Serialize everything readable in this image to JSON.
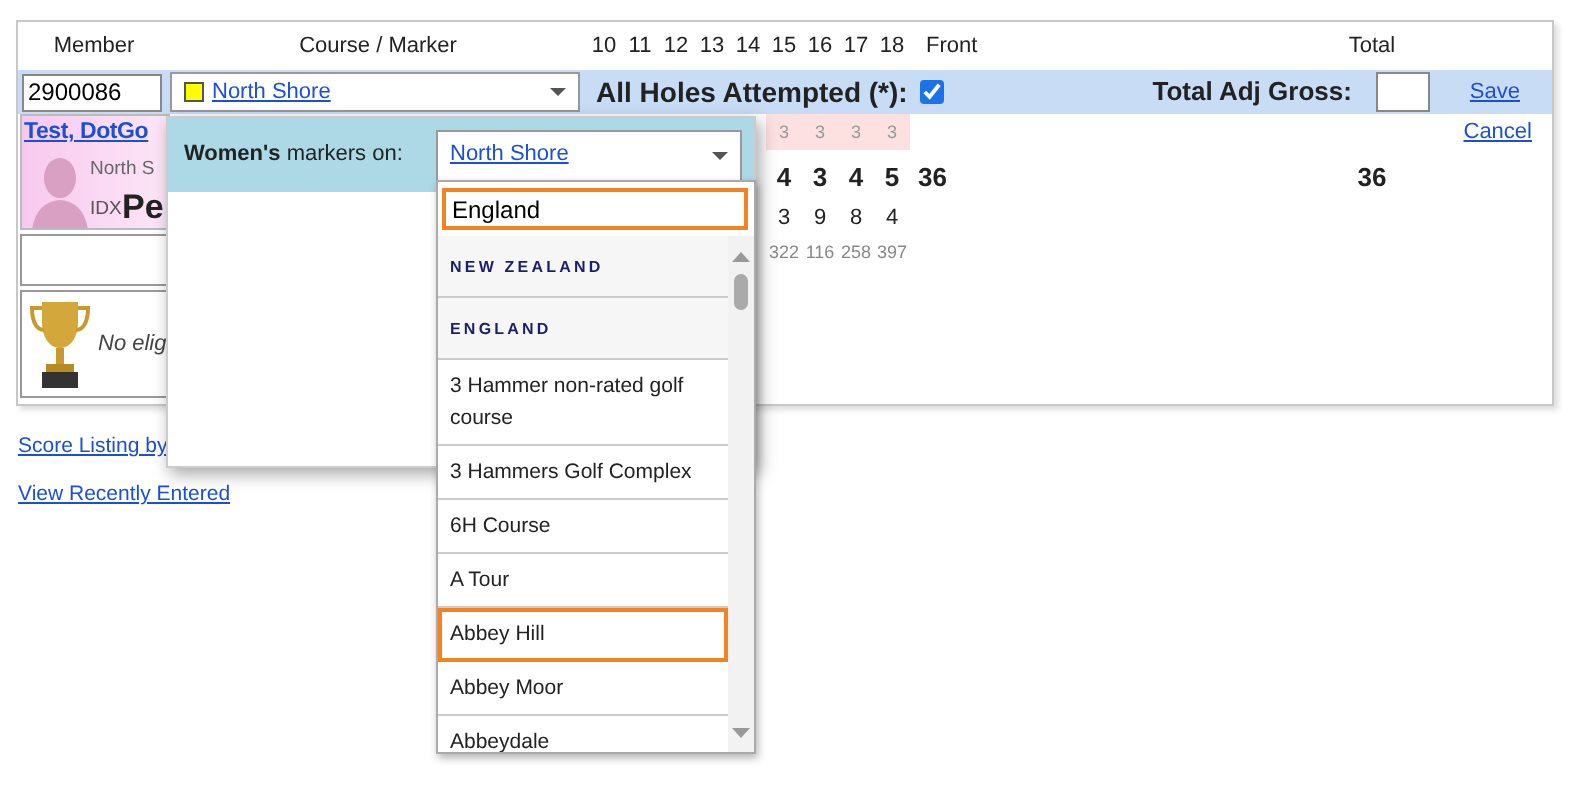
{
  "columns": [
    "Member",
    "Course / Marker",
    "10",
    "11",
    "12",
    "13",
    "14",
    "15",
    "16",
    "17",
    "18",
    "Front",
    "Total"
  ],
  "entry": {
    "member_id": "2900086",
    "course": {
      "label": "North Shore",
      "color": "#ffff00"
    },
    "all_holes_label": "All Holes Attempted (*):",
    "all_holes_checked": true,
    "total_label": "Total Adj Gross:",
    "save": "Save"
  },
  "player": {
    "name": "Test, DotGo",
    "club": "North S",
    "idx_label": "IDX",
    "handicap": "Pe"
  },
  "cancel": "Cancel",
  "par_cells": [
    "3",
    "3",
    "3",
    "3"
  ],
  "scores": [
    "4",
    "3",
    "4",
    "5"
  ],
  "front": "36",
  "total": "36",
  "stroke_index": [
    "3",
    "9",
    "8",
    "4"
  ],
  "yardage": [
    "322",
    "116",
    "258",
    "397"
  ],
  "competition": "No elig",
  "links": [
    "Score Listing by",
    "View Recently Entered"
  ],
  "popup": {
    "label": "**Women's** markers on:",
    "select": "North Shore"
  },
  "dropdown": {
    "search": "England",
    "items": [
      {
        "kind": "group",
        "label": "NEW ZEALAND",
        "selected": false
      },
      {
        "kind": "group",
        "label": "ENGLAND",
        "selected": false
      },
      {
        "kind": "option",
        "label": "3 Hammer non-rated golf course",
        "selected": false
      },
      {
        "kind": "option",
        "label": "3 Hammers Golf Complex",
        "selected": false
      },
      {
        "kind": "option",
        "label": "6H Course",
        "selected": false
      },
      {
        "kind": "option",
        "label": "A Tour",
        "selected": false
      },
      {
        "kind": "option",
        "label": "Abbey Hill",
        "selected": true
      },
      {
        "kind": "option",
        "label": "Abbey Moor",
        "selected": false
      },
      {
        "kind": "option",
        "label": "Abbeydale",
        "selected": false
      }
    ]
  }
}
